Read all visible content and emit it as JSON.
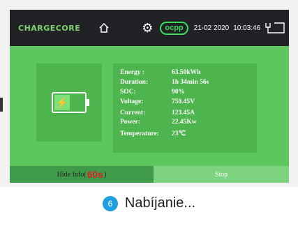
{
  "topbar": {
    "logo": "CHARGECORE",
    "ocpp_label": "ocpp",
    "date": "21-02 2020",
    "time": "10:03:46"
  },
  "info": [
    {
      "label": "Energy :",
      "value": "63.50kWh"
    },
    {
      "label": "Duration:",
      "value": "1h 34min 56s"
    },
    {
      "label": "SOC:",
      "value": "90%"
    },
    {
      "label": "Voltage:",
      "value": "750.45V"
    },
    {
      "label": "Current:",
      "value": "123.45A"
    },
    {
      "label": "Power:",
      "value": "22.45Kw"
    },
    {
      "label": "Temperature:",
      "value": "23℃"
    }
  ],
  "bottombar": {
    "hide_prefix": "Hide Info(",
    "hide_seconds": "60s",
    "hide_suffix": ")",
    "stop_label": "Stop"
  },
  "caption": {
    "badge": "6",
    "text": "Nabíjanie..."
  },
  "colors": {
    "screen_bg": "#5ec65e",
    "topbar_bg": "#202226",
    "card_bg": "#4eb44e",
    "ocpp_accent": "#3ddc5a",
    "countdown": "#e02020",
    "badge": "#1e9fe0"
  },
  "icons": [
    "home-icon",
    "gear-icon",
    "ocpp-badge",
    "plug-icon",
    "battery-icon",
    "lightning-icon"
  ]
}
